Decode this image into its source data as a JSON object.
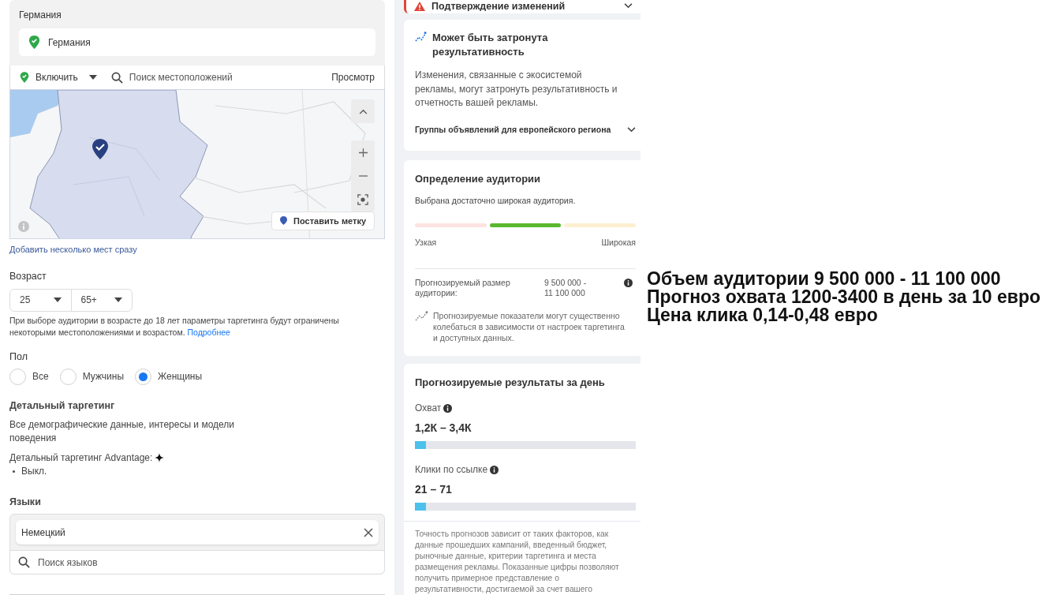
{
  "location": {
    "section_title": "Германия",
    "selected_location": "Германия",
    "mode": "Включить",
    "search_placeholder": "Поиск местоположений",
    "view_link": "Просмотр",
    "map": {
      "kind": "picture",
      "drop_pin_button": "Поставить метку"
    },
    "add_multiple_link": "Добавить несколько мест сразу"
  },
  "age": {
    "label": "Возраст",
    "min": "25",
    "max": "65+",
    "note": "При выборе аудитории в возрасте до 18 лет параметры таргетинга будут ограничены некоторыми местоположениями и возрастом.",
    "note_link": "Подробнее"
  },
  "gender": {
    "label": "Пол",
    "options": [
      {
        "label": "Все",
        "selected": false
      },
      {
        "label": "Мужчины",
        "selected": false
      },
      {
        "label": "Женщины",
        "selected": true
      }
    ]
  },
  "detailed_targeting": {
    "title": "Детальный таргетинг",
    "description": "Все демографические данные, интересы и модели поведения",
    "advantage_label": "Детальный таргетинг Advantage:",
    "advantage_items": [
      "Выкл."
    ]
  },
  "languages": {
    "label": "Языки",
    "selected": "Немецкий",
    "search_placeholder": "Поиск языков"
  },
  "changes_banner": {
    "title": "Подтверждение изменений"
  },
  "performance_notice": {
    "title": "Может быть затронута результативность",
    "text": "Изменения, связанные с экосистемой рекламы, могут затронуть результативность и отчетность вашей рекламы.",
    "accordion": "Группы объявлений для европейского региона"
  },
  "audience": {
    "title": "Определение аудитории",
    "status": "Выбрана достаточно широкая аудитория.",
    "segments": [
      {
        "selected": false
      },
      {
        "selected": true
      },
      {
        "selected": false
      }
    ],
    "narrow_label": "Узкая",
    "broad_label": "Широкая",
    "size_label": "Прогнозируемый размер аудитории:",
    "size_value": "9 500 000 - 11 100 000",
    "note": "Прогнозируемые показатели могут существенно колебаться в зависимости от настроек таргетинга и доступных данных."
  },
  "daily_results": {
    "title": "Прогнозируемые результаты за день",
    "metrics": [
      {
        "label": "Охват",
        "value": "1,2К – 3,4К",
        "level": 0.05
      },
      {
        "label": "Клики по ссылке",
        "value": "21 – 71",
        "level": 0.05
      }
    ],
    "disclaimer": "Точность прогнозов зависит от таких факторов, как данные прошедших кампаний, введенный бюджет, рыночные данные, критерии таргетинга и места размещения рекламы. Показанные цифры позволяют получить примерное представление о результативности, достигаемой за счет вашего"
  },
  "notes": [
    "Объем аудитории 9 500 000 - 11 100 000",
    "Прогноз охвата 1200-3400 в день за 10 евро",
    "Цена клика 0,14-0,48 евро"
  ]
}
